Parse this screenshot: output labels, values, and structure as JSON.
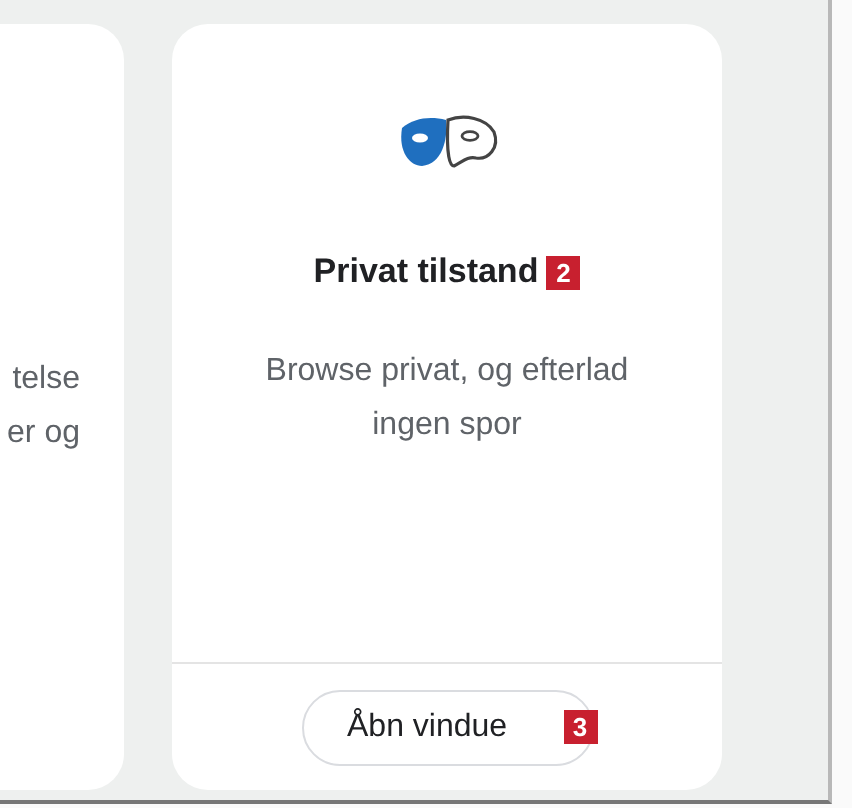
{
  "cards": [
    {
      "kind": "partial",
      "description_lines": [
        "telse",
        "er og"
      ]
    },
    {
      "kind": "full",
      "title": "Privat tilstand",
      "title_badge": "2",
      "description_lines": [
        "Browse privat, og efterlad",
        "ingen spor"
      ],
      "button": {
        "label": "Åbn vindue",
        "badge": "3"
      }
    }
  ]
}
